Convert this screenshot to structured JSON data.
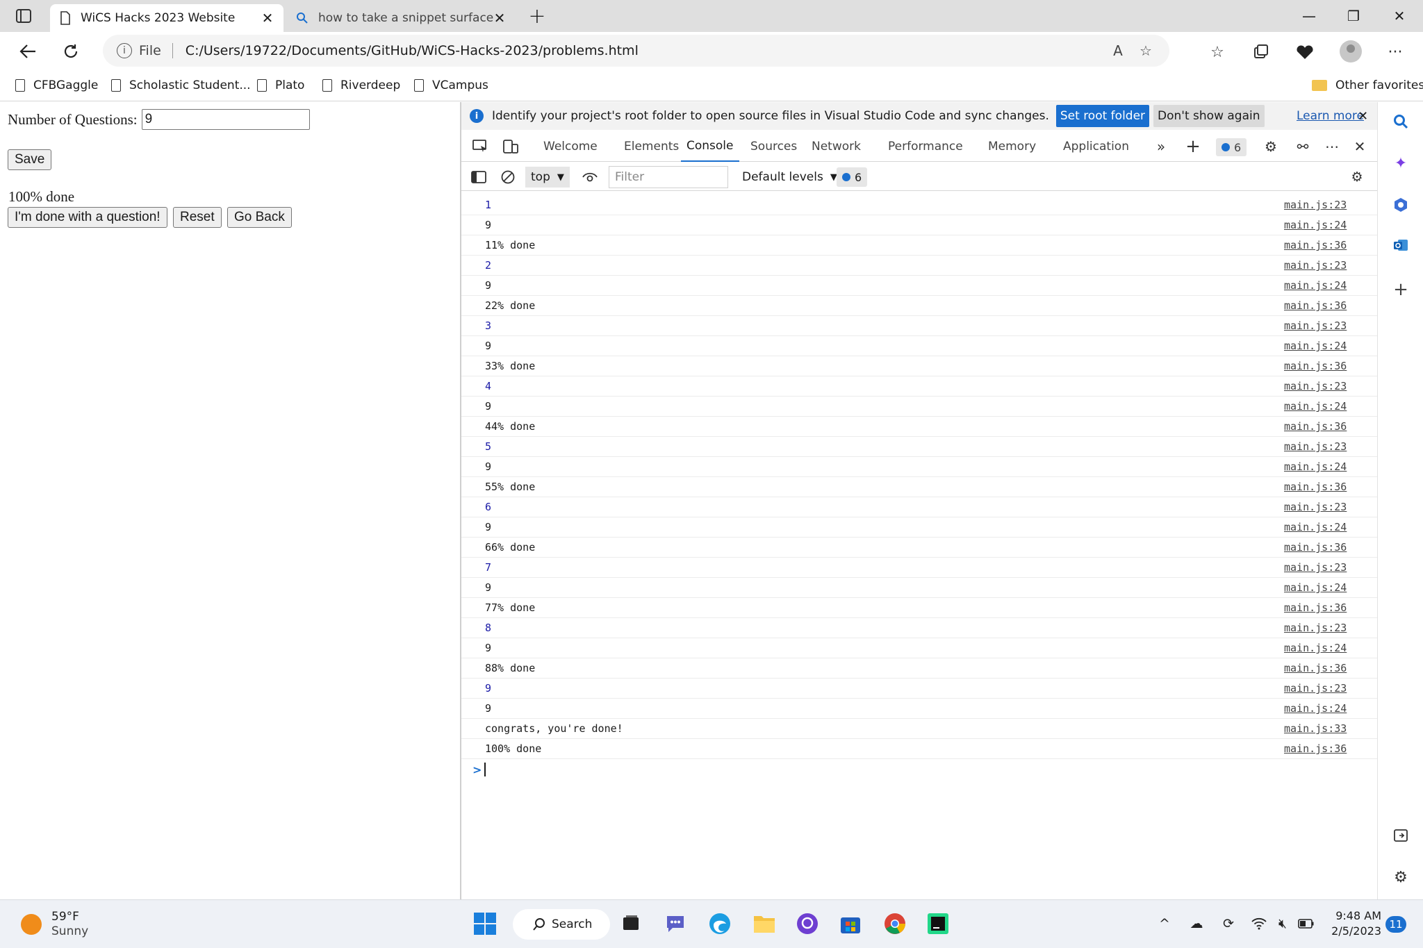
{
  "tabs": [
    {
      "title": "WiCS Hacks 2023 Website"
    },
    {
      "title": "how to take a snippet surface pro"
    }
  ],
  "address": {
    "scheme": "File",
    "url": "C:/Users/19722/Documents/GitHub/WiCS-Hacks-2023/problems.html"
  },
  "favorites": [
    "CFBGaggle",
    "Scholastic Student...",
    "Plato",
    "Riverdeep",
    "VCampus"
  ],
  "other_favorites": "Other favorites",
  "page": {
    "questions_label": "Number of Questions:",
    "questions_value": "9",
    "save_label": "Save",
    "progress_text": "100% done",
    "done_label": "I'm done with a question!",
    "reset_label": "Reset",
    "back_label": "Go Back"
  },
  "devtools": {
    "infobar": {
      "message": "Identify your project's root folder to open source files in Visual Studio Code and sync changes.",
      "set_root": "Set root folder",
      "dont_show": "Don't show again",
      "learn_more": "Learn more"
    },
    "tabs": [
      "Welcome",
      "Elements",
      "Console",
      "Sources",
      "Network",
      "Performance",
      "Memory",
      "Application"
    ],
    "active_tab": "Console",
    "issues_count": "6",
    "console_toolbar": {
      "context": "top",
      "filter_placeholder": "Filter",
      "levels": "Default levels",
      "messages_count": "6"
    },
    "log": [
      {
        "msg": "1",
        "num": true,
        "src": "main.js:23"
      },
      {
        "msg": "9",
        "num": false,
        "src": "main.js:24"
      },
      {
        "msg": "11% done",
        "num": false,
        "src": "main.js:36"
      },
      {
        "msg": "2",
        "num": true,
        "src": "main.js:23"
      },
      {
        "msg": "9",
        "num": false,
        "src": "main.js:24"
      },
      {
        "msg": "22% done",
        "num": false,
        "src": "main.js:36"
      },
      {
        "msg": "3",
        "num": true,
        "src": "main.js:23"
      },
      {
        "msg": "9",
        "num": false,
        "src": "main.js:24"
      },
      {
        "msg": "33% done",
        "num": false,
        "src": "main.js:36"
      },
      {
        "msg": "4",
        "num": true,
        "src": "main.js:23"
      },
      {
        "msg": "9",
        "num": false,
        "src": "main.js:24"
      },
      {
        "msg": "44% done",
        "num": false,
        "src": "main.js:36"
      },
      {
        "msg": "5",
        "num": true,
        "src": "main.js:23"
      },
      {
        "msg": "9",
        "num": false,
        "src": "main.js:24"
      },
      {
        "msg": "55% done",
        "num": false,
        "src": "main.js:36"
      },
      {
        "msg": "6",
        "num": true,
        "src": "main.js:23"
      },
      {
        "msg": "9",
        "num": false,
        "src": "main.js:24"
      },
      {
        "msg": "66% done",
        "num": false,
        "src": "main.js:36"
      },
      {
        "msg": "7",
        "num": true,
        "src": "main.js:23"
      },
      {
        "msg": "9",
        "num": false,
        "src": "main.js:24"
      },
      {
        "msg": "77% done",
        "num": false,
        "src": "main.js:36"
      },
      {
        "msg": "8",
        "num": true,
        "src": "main.js:23"
      },
      {
        "msg": "9",
        "num": false,
        "src": "main.js:24"
      },
      {
        "msg": "88% done",
        "num": false,
        "src": "main.js:36"
      },
      {
        "msg": "9",
        "num": true,
        "src": "main.js:23"
      },
      {
        "msg": "9",
        "num": false,
        "src": "main.js:24"
      },
      {
        "msg": "congrats, you're done!",
        "num": false,
        "src": "main.js:33"
      },
      {
        "msg": "100% done",
        "num": false,
        "src": "main.js:36"
      }
    ]
  },
  "taskbar": {
    "temperature": "59°F",
    "condition": "Sunny",
    "search_label": "Search",
    "time": "9:48 AM",
    "date": "2/5/2023",
    "notifications": "11"
  },
  "colors": {
    "accent": "#1a6fcf",
    "tabstrip": "#dfdfdf",
    "console_number": "#1a1aa6"
  }
}
